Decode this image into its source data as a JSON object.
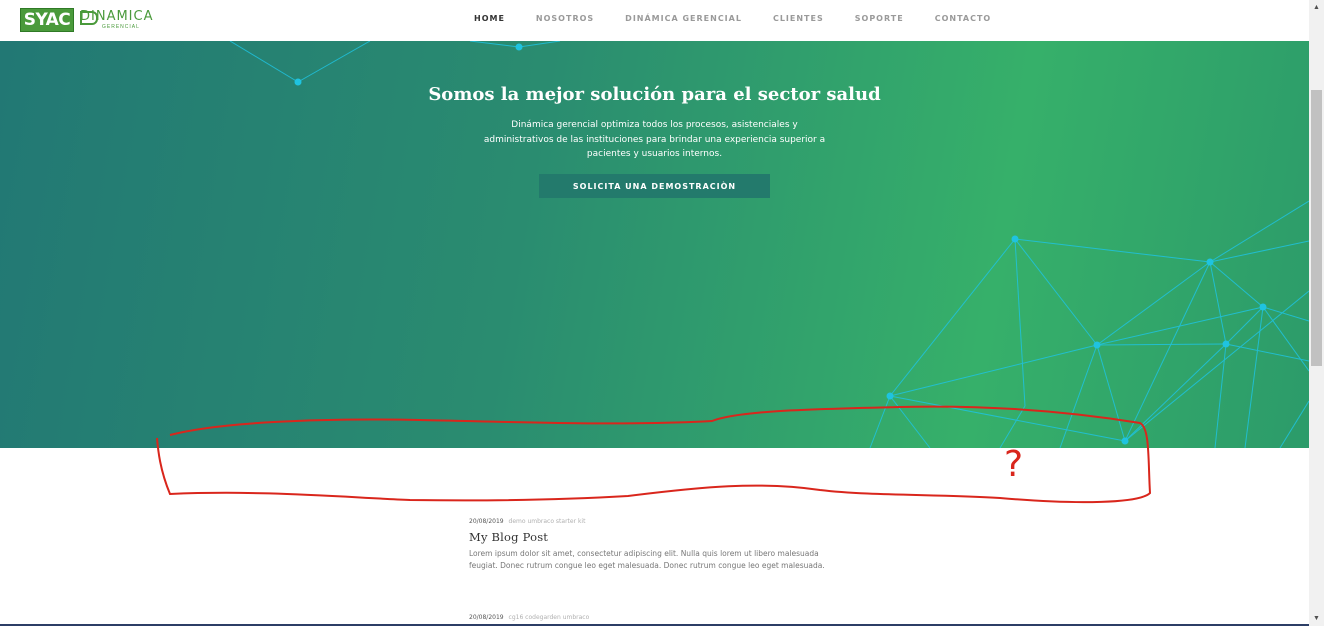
{
  "header": {
    "logo_primary": "SYAC",
    "logo_word": "DINAMICA",
    "logo_sub": "GERENCIAL",
    "nav": [
      {
        "label": "HOME",
        "active": true
      },
      {
        "label": "NOSOTROS",
        "active": false
      },
      {
        "label": "DINÁMICA GERENCIAL",
        "active": false
      },
      {
        "label": "CLIENTES",
        "active": false
      },
      {
        "label": "SOPORTE",
        "active": false
      },
      {
        "label": "CONTACTO",
        "active": false
      }
    ]
  },
  "hero": {
    "title": "Somos la mejor solución para el sector salud",
    "text": "Dinámica gerencial optimiza todos los procesos, asistenciales y administrativos de las instituciones para brindar una experiencia superior a pacientes y usuarios internos.",
    "cta": "SOLICITA UNA DEMOSTRACIÒN"
  },
  "posts": [
    {
      "date": "20/08/2019",
      "tags": "demo umbraco starter kit",
      "title": "My Blog Post",
      "excerpt": "Lorem ipsum dolor sit amet, consectetur adipiscing elit. Nulla quis lorem ut libero malesuada feugiat. Donec rutrum congue leo eget malesuada. Donec rutrum congue leo eget malesuada."
    },
    {
      "date": "20/08/2019",
      "tags": "cg16 codegarden umbraco"
    }
  ],
  "annotation": {
    "text": "?",
    "color": "#d9261c"
  },
  "colors": {
    "brand_green": "#4a9a3b",
    "hero_start": "#227874",
    "hero_end": "#36b06a",
    "network": "#1fc3e0",
    "cta_bg": "#237a6c"
  }
}
